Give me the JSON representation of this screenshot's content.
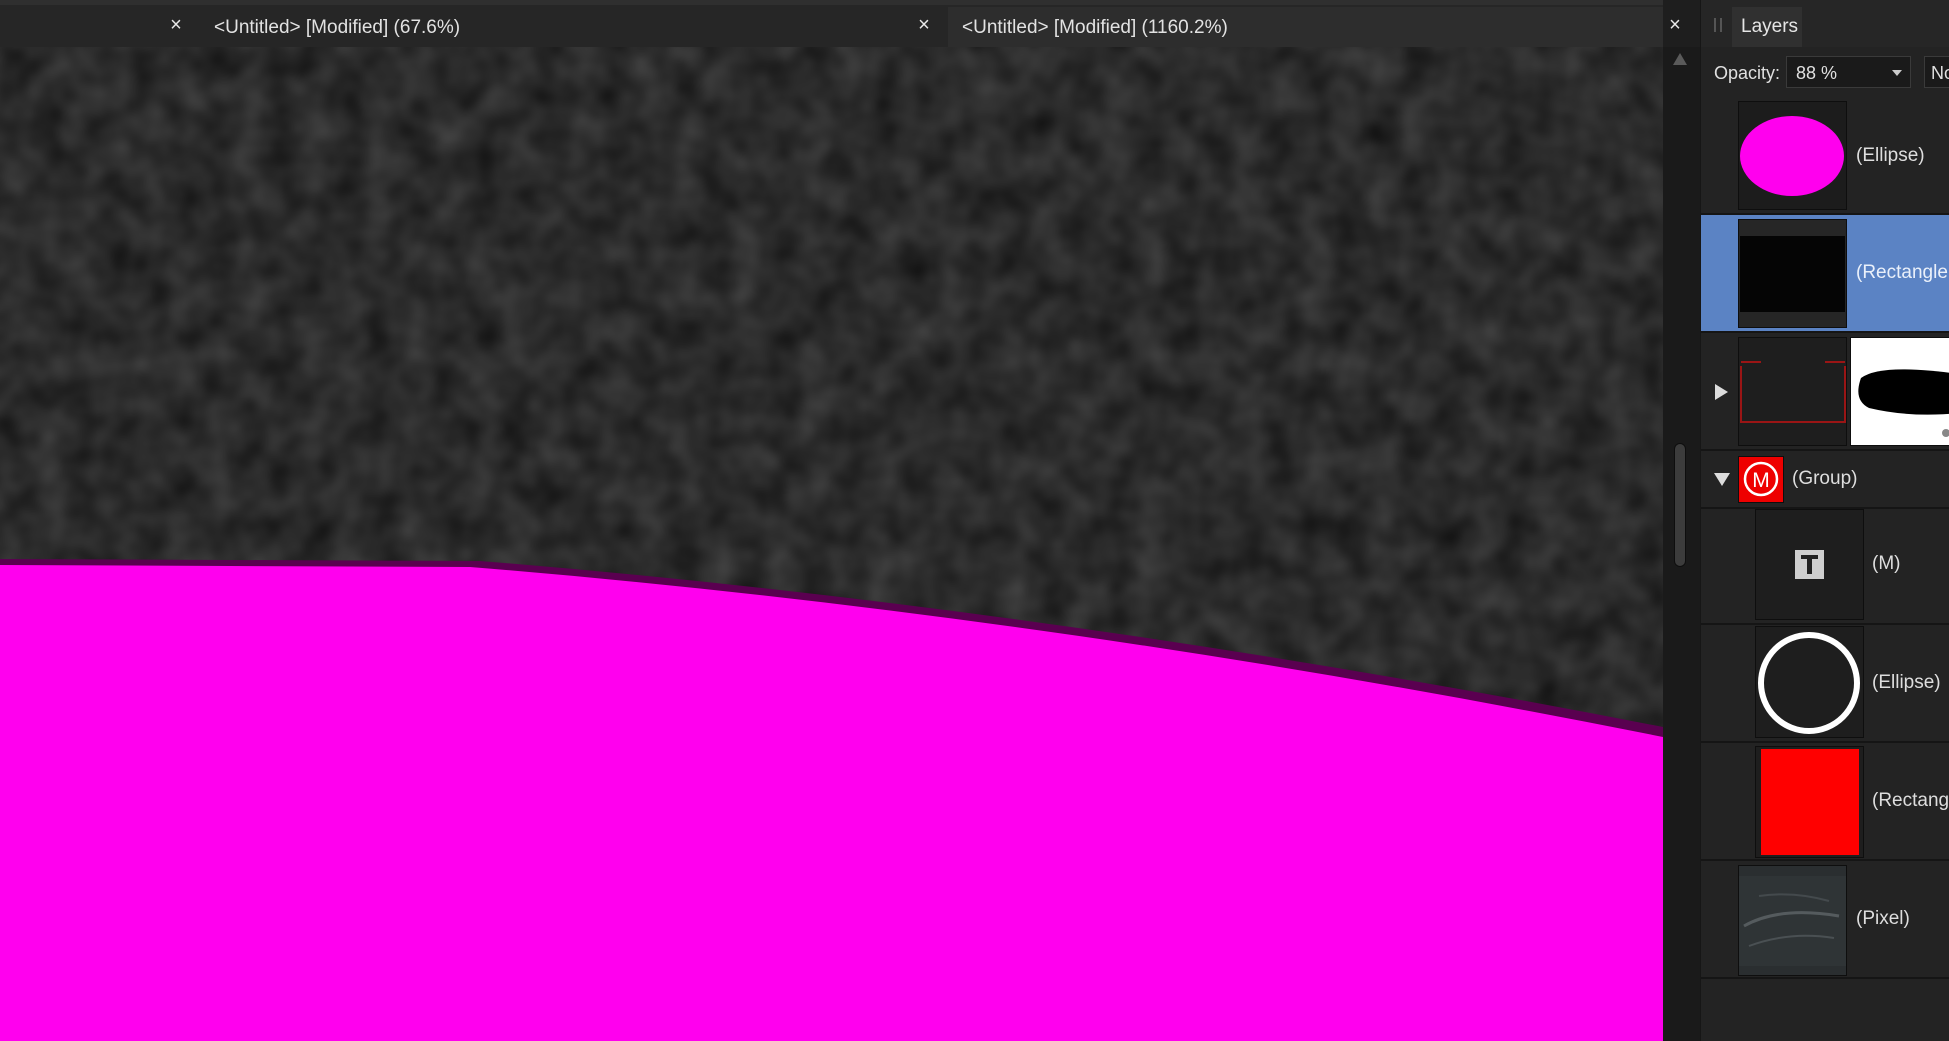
{
  "tabs": [
    {
      "label": "",
      "close": "×"
    },
    {
      "label": "<Untitled> [Modified] (67.6%)",
      "close": "×"
    },
    {
      "label": "<Untitled> [Modified] (1160.2%)",
      "close": "×"
    }
  ],
  "canvas": {
    "background_color": "#111111",
    "shape_fill_color": "#ff00ee"
  },
  "layers_panel": {
    "tab_label": "Layers",
    "opacity_label": "Opacity:",
    "opacity_value": "88 %",
    "blend_mode_visible": "No",
    "layers": [
      {
        "name": "(Ellipse)",
        "thumbnail": "magenta-ellipse",
        "selected": false
      },
      {
        "name": "(Rectangle",
        "thumbnail": "black-rectangle",
        "selected": true
      },
      {
        "name": "",
        "thumbnail": "pixel-with-mask",
        "selected": false,
        "expandable": true
      },
      {
        "name": "(Group)",
        "thumbnail": "circle-m-logo",
        "logo_letter": "M",
        "expanded": true
      },
      {
        "name": "(M)",
        "thumbnail": "text-T-icon",
        "child": true
      },
      {
        "name": "(Ellipse)",
        "thumbnail": "white-ring",
        "child": true
      },
      {
        "name": "(Rectang",
        "thumbnail": "red-rectangle",
        "child": true
      },
      {
        "name": "(Pixel)",
        "thumbnail": "dark-texture"
      }
    ],
    "selection_color": "#5b83c4"
  }
}
